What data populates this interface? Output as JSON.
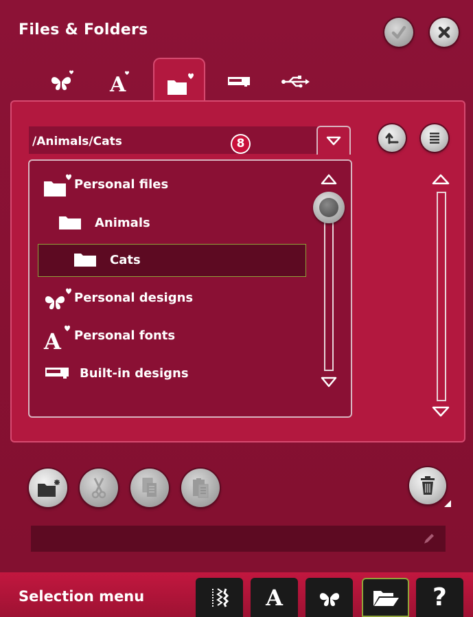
{
  "header": {
    "title": "Files & Folders"
  },
  "tabs": [
    {
      "name": "personal-designs-tab",
      "active": false
    },
    {
      "name": "personal-fonts-tab",
      "active": false
    },
    {
      "name": "personal-files-tab",
      "active": true
    },
    {
      "name": "built-in-designs-tab",
      "active": false
    },
    {
      "name": "usb-tab",
      "active": false
    }
  ],
  "path": {
    "value": "/Animals/Cats",
    "badge": "8"
  },
  "tree": {
    "items": [
      {
        "label": "Personal files",
        "icon": "folder-heart-icon",
        "indent": 0,
        "selected": false
      },
      {
        "label": "Animals",
        "icon": "folder-icon",
        "indent": 1,
        "selected": false
      },
      {
        "label": "Cats",
        "icon": "folder-icon",
        "indent": 2,
        "selected": true
      },
      {
        "label": "Personal designs",
        "icon": "butterfly-heart-icon",
        "indent": 0,
        "selected": false
      },
      {
        "label": "Personal fonts",
        "icon": "font-heart-icon",
        "indent": 0,
        "selected": false
      },
      {
        "label": "Built-in designs",
        "icon": "sewing-machine-icon",
        "indent": 0,
        "selected": false
      }
    ]
  },
  "field": {
    "value": ""
  },
  "bottom": {
    "label": "Selection menu",
    "buttons": [
      "stitch-menu-icon",
      "font-icon",
      "butterfly-icon",
      "open-folder-icon",
      "help-icon"
    ],
    "help_glyph": "?",
    "font_glyph": "A"
  },
  "colors": {
    "accent": "#b3183f",
    "selected_border": "#8fa33a",
    "background": "#82102f"
  }
}
